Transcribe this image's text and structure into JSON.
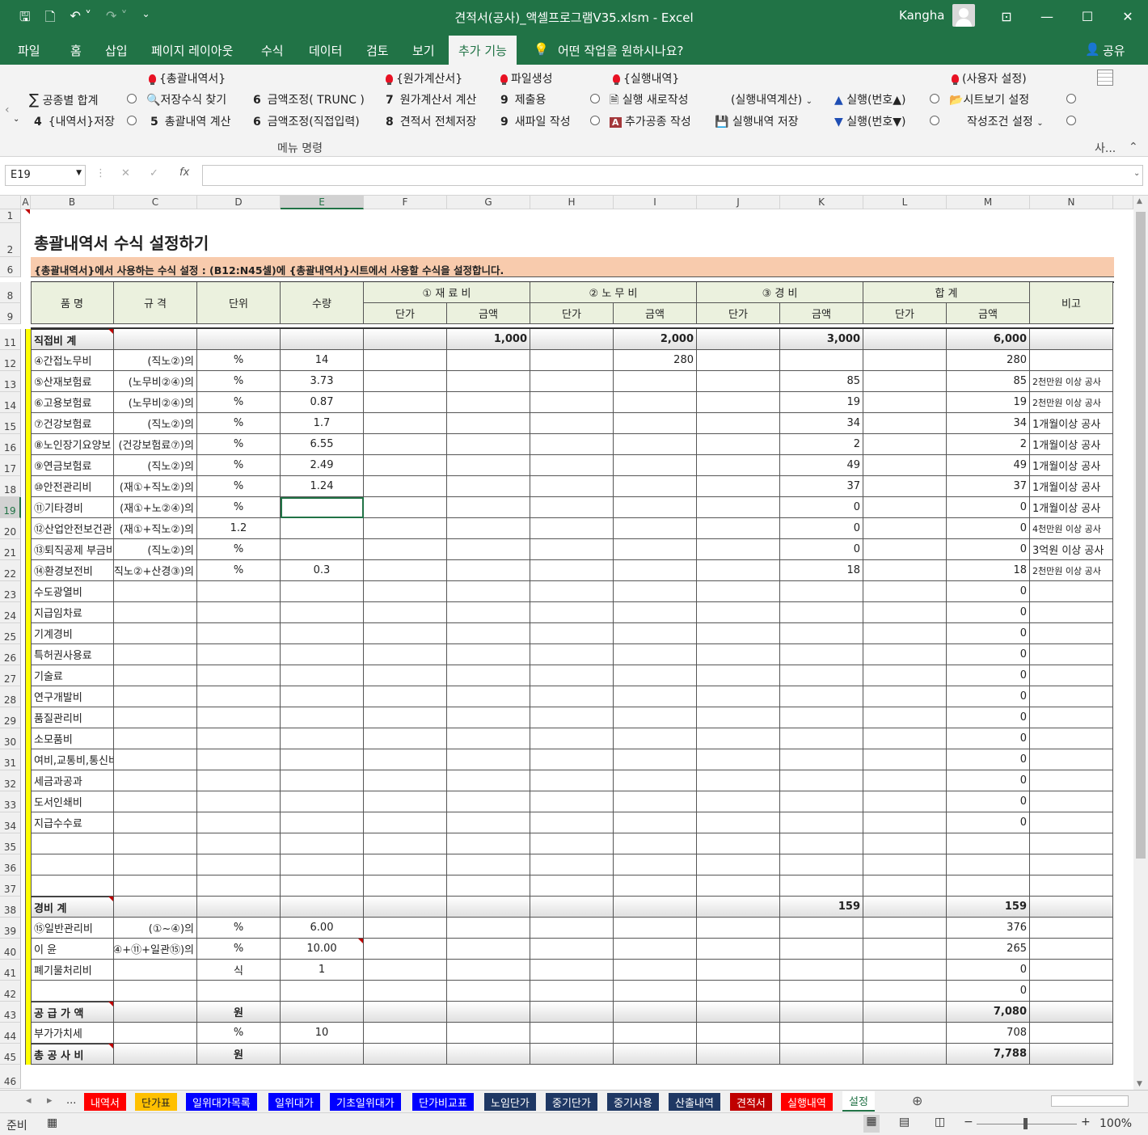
{
  "window": {
    "title": "견적서(공사)_액셀프로그램V35.xlsm  -  Excel",
    "user": "Kangha"
  },
  "tabs": [
    "파일",
    "홈",
    "삽입",
    "페이지 레이아웃",
    "수식",
    "데이터",
    "검토",
    "보기",
    "추가 기능"
  ],
  "tell_me": "어떤 작업을 원하시나요?",
  "share": "공유",
  "ribbon": {
    "h1": "{총괄내역서}",
    "h2": "{원가계산서}",
    "h3": "파일생성",
    "h4": "{실행내역}",
    "h5": "(사용자 설정)",
    "r1": {
      "a": "공종별 합계",
      "b": "저장수식 찾기",
      "c_n": "6",
      "c": "금액조정( TRUNC )",
      "d_n": "7",
      "d": "원가계산서 계산",
      "e_n": "9",
      "e": "제출용",
      "f": "실행 새로작성",
      "g": "(실행내역계산)",
      "h": "실행(번호▲)",
      "i": "시트보기 설정"
    },
    "r2": {
      "a_n": "4",
      "a": "{내역서}저장",
      "b_n": "5",
      "b": "총괄내역 계산",
      "c_n": "6",
      "c": "금액조정(직접입력)",
      "d_n": "8",
      "d": "견적서 전체저장",
      "e_n": "9",
      "e": "새파일 작성",
      "f": "추가공종 작성",
      "g": "실행내역 저장",
      "h": "실행(번호▼)",
      "i": "작성조건 설정"
    },
    "group": "메뉴 명령",
    "group2": "사..."
  },
  "namebox": "E19",
  "col_letters": [
    "A",
    "B",
    "C",
    "D",
    "E",
    "F",
    "G",
    "H",
    "I",
    "J",
    "K",
    "L",
    "M",
    "N"
  ],
  "sheet": {
    "title": "총괄내역서 수식 설정하기",
    "banner": "{총괄내역서}에서 사용하는 수식 설정 : (B12:N45셀)에 {총괄내역서}시트에서 사용할 수식을 설정합니다.",
    "hdr": {
      "name": "품      명",
      "spec": "규    격",
      "unit": "단위",
      "qty": "수량",
      "mat": "① 재 료 비",
      "lab": "② 노 무 비",
      "exp": "③ 경    비",
      "tot": "합     계",
      "note": "비고",
      "price": "단가",
      "amount": "금액"
    },
    "rows": [
      {
        "n": "11",
        "B": "직접비 계",
        "G": "1,000",
        "I": "2,000",
        "K": "3,000",
        "M": "6,000",
        "bold": true,
        "gray": true
      },
      {
        "n": "12",
        "B": "④간접노무비",
        "C": "(직노②)의",
        "D": "%",
        "E": "14",
        "I": "280",
        "M": "280"
      },
      {
        "n": "13",
        "B": "⑤산재보험료",
        "C": "(노무비②④)의",
        "D": "%",
        "E": "3.73",
        "K": "85",
        "M": "85",
        "N": "2천만원 이상 공사",
        "ns": true
      },
      {
        "n": "14",
        "B": "⑥고용보험료",
        "C": "(노무비②④)의",
        "D": "%",
        "E": "0.87",
        "K": "19",
        "M": "19",
        "N": "2천만원 이상 공사",
        "ns": true
      },
      {
        "n": "15",
        "B": "⑦건강보험료",
        "C": "(직노②)의",
        "D": "%",
        "E": "1.7",
        "K": "34",
        "M": "34",
        "N": "1개월이상 공사"
      },
      {
        "n": "16",
        "B": "⑧노인장기요양보",
        "C": "(건강보험료⑦)의",
        "D": "%",
        "E": "6.55",
        "K": "2",
        "M": "2",
        "N": "1개월이상 공사"
      },
      {
        "n": "17",
        "B": "⑨연금보험료",
        "C": "(직노②)의",
        "D": "%",
        "E": "2.49",
        "K": "49",
        "M": "49",
        "N": "1개월이상 공사"
      },
      {
        "n": "18",
        "B": "⑩안전관리비",
        "C": "(재①+직노②)의",
        "D": "%",
        "E": "1.24",
        "K": "37",
        "M": "37",
        "N": "1개월이상 공사"
      },
      {
        "n": "19",
        "B": "⑪기타경비",
        "C": "(재①+노②④)의",
        "D": "%",
        "E": "",
        "K": "0",
        "M": "0",
        "N": "1개월이상 공사"
      },
      {
        "n": "20",
        "B": "⑫산업안전보건관",
        "C": "(재①+직노②)의",
        "D": "1.2",
        "K": "0",
        "M": "0",
        "N": "4천만원 이상 공사",
        "ns": true
      },
      {
        "n": "21",
        "B": "⑬퇴직공제 부금비",
        "C": "(직노②)의",
        "D": "%",
        "K": "0",
        "M": "0",
        "N": "3억원 이상 공사"
      },
      {
        "n": "22",
        "B": "⑭환경보전비",
        "C": "직노②+산경③)의",
        "D": "%",
        "E": "0.3",
        "K": "18",
        "M": "18",
        "N": "2천만원 이상 공사",
        "ns": true
      },
      {
        "n": "23",
        "B": "수도광열비",
        "M": "0"
      },
      {
        "n": "24",
        "B": "지급임차료",
        "M": "0"
      },
      {
        "n": "25",
        "B": "기계경비",
        "M": "0"
      },
      {
        "n": "26",
        "B": "특허권사용료",
        "M": "0"
      },
      {
        "n": "27",
        "B": "기술료",
        "M": "0"
      },
      {
        "n": "28",
        "B": "연구개발비",
        "M": "0"
      },
      {
        "n": "29",
        "B": "품질관리비",
        "M": "0"
      },
      {
        "n": "30",
        "B": "소모품비",
        "M": "0"
      },
      {
        "n": "31",
        "B": "여비,교통비,통신비",
        "M": "0"
      },
      {
        "n": "32",
        "B": "세금과공과",
        "M": "0"
      },
      {
        "n": "33",
        "B": "도서인쇄비",
        "M": "0"
      },
      {
        "n": "34",
        "B": "지급수수료",
        "M": "0"
      },
      {
        "n": "35"
      },
      {
        "n": "36"
      },
      {
        "n": "37"
      },
      {
        "n": "38",
        "B": "경비  계",
        "K": "159",
        "M": "159",
        "bold": true,
        "gray": true
      },
      {
        "n": "39",
        "B": "⑮일반관리비",
        "C": "(①~④)의",
        "D": "%",
        "E": "6.00",
        "M": "376"
      },
      {
        "n": "40",
        "B": "이    윤",
        "C": "④+⑪+일관⑮)의",
        "D": "%",
        "E": "10.00",
        "M": "265"
      },
      {
        "n": "41",
        "B": "폐기물처리비",
        "D": "식",
        "E": "1",
        "M": "0"
      },
      {
        "n": "42",
        "M": "0"
      },
      {
        "n": "43",
        "B": "공 급 가 액",
        "D": "원",
        "M": "7,080",
        "bold": true,
        "gray": true
      },
      {
        "n": "44",
        "B": "부가가치세",
        "D": "%",
        "E": "10",
        "M": "708"
      },
      {
        "n": "45",
        "B": "총 공 사 비",
        "D": "원",
        "M": "7,788",
        "bold": true,
        "gray": true
      }
    ]
  },
  "sheet_tabs": [
    {
      "label": "내역서",
      "color": "#ff0000"
    },
    {
      "label": "단가표",
      "color": "#ffc000",
      "dark": true
    },
    {
      "label": "일위대가목록",
      "color": "#0000ff"
    },
    {
      "label": "일위대가",
      "color": "#0000ff"
    },
    {
      "label": "기초일위대가",
      "color": "#0000ff"
    },
    {
      "label": "단가비교표",
      "color": "#0000ff"
    },
    {
      "label": "노임단가",
      "color": "#1f3864"
    },
    {
      "label": "중기단가",
      "color": "#1f3864"
    },
    {
      "label": "중기사용",
      "color": "#1f3864"
    },
    {
      "label": "산출내역",
      "color": "#1f3864"
    },
    {
      "label": "견적서",
      "color": "#c00000"
    },
    {
      "label": "실행내역",
      "color": "#ff0000"
    },
    {
      "label": "설정",
      "color": "#ffffff",
      "dark": true,
      "active": true
    }
  ],
  "status": {
    "ready": "준비",
    "zoom": "100%"
  }
}
